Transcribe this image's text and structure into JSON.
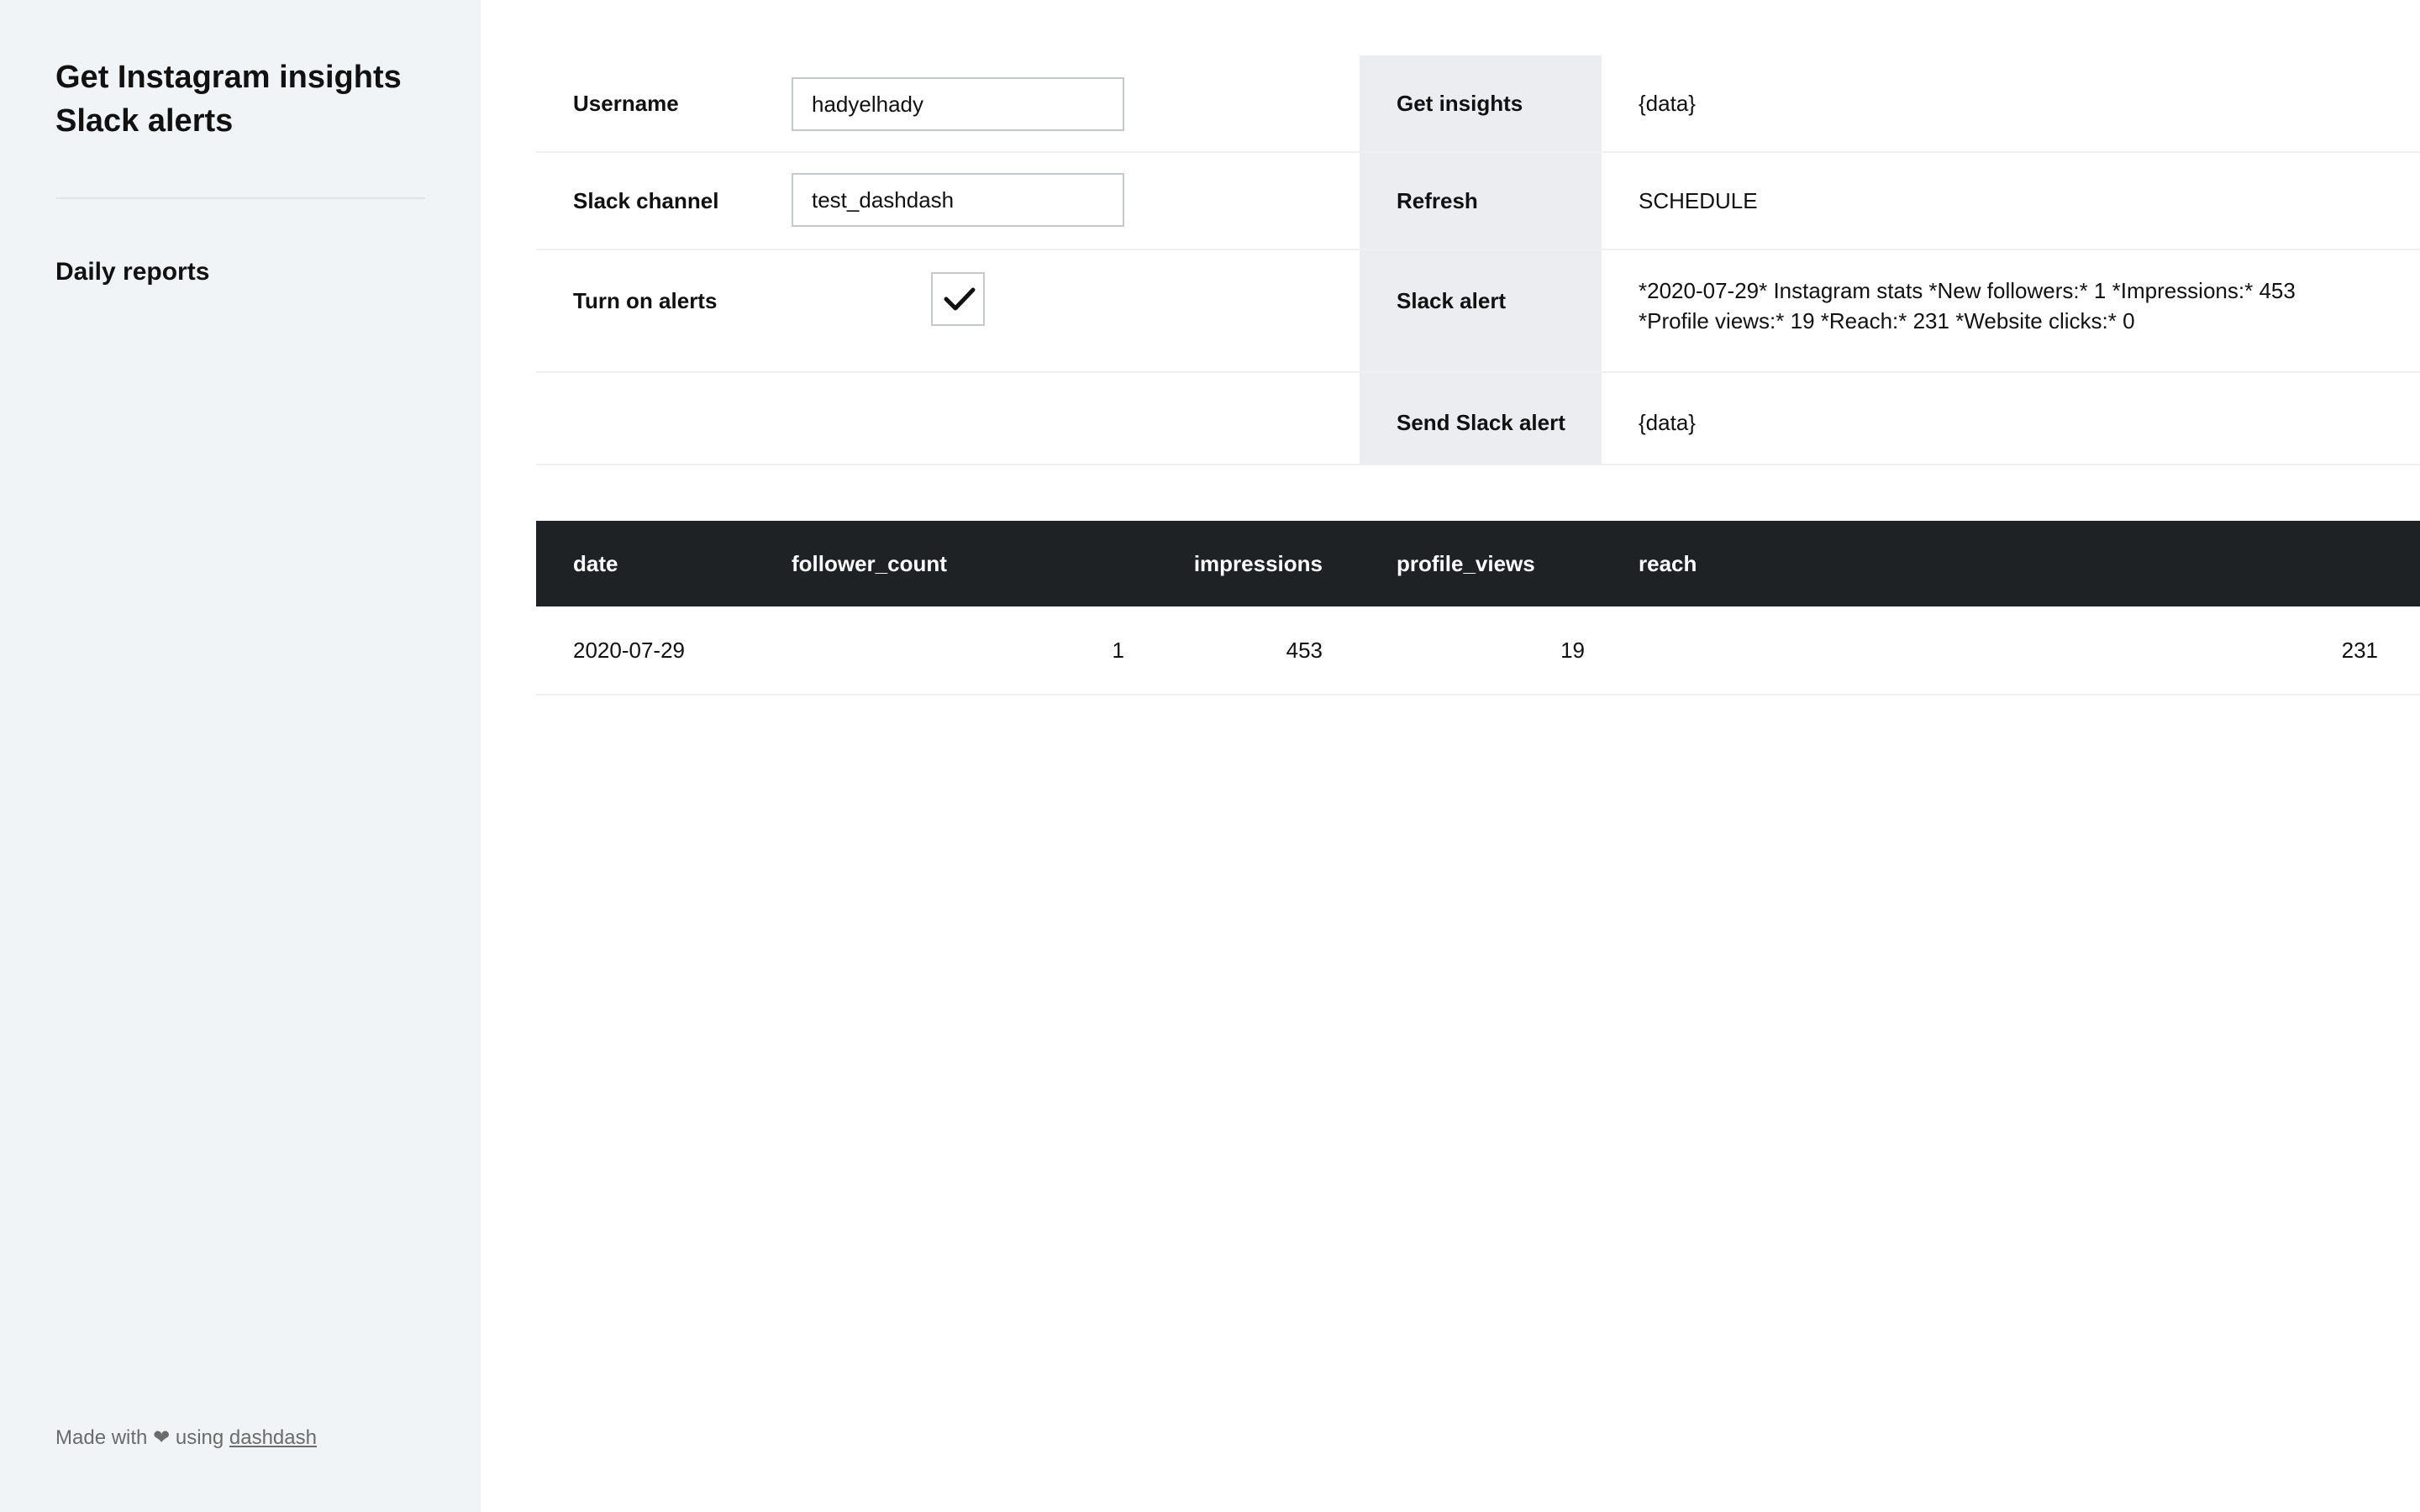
{
  "sidebar": {
    "title": "Get Instagram insights Slack alerts",
    "nav_item": "Daily reports",
    "footer": {
      "made_with": "Made with",
      "heart": "❤",
      "using": "using",
      "link": "dashdash"
    }
  },
  "form": {
    "username": {
      "label": "Username",
      "value": "hadyelhady"
    },
    "slack_channel": {
      "label": "Slack channel",
      "value": "test_dashdash"
    },
    "alerts": {
      "label": "Turn on alerts",
      "checked": true
    }
  },
  "actions": {
    "get_insights": {
      "label": "Get insights",
      "value": "{data}"
    },
    "refresh": {
      "label": "Refresh",
      "value": "SCHEDULE"
    },
    "slack_alert": {
      "label": "Slack alert",
      "line1": "*2020-07-29* Instagram stats *New followers:* 1 *Impressions:* 453",
      "line2": "*Profile views:* 19 *Reach:* 231 *Website clicks:* 0"
    },
    "send_slack_alert": {
      "label": "Send Slack alert",
      "value": "{data}"
    }
  },
  "table": {
    "columns": [
      "date",
      "follower_count",
      "impressions",
      "profile_views",
      "reach"
    ],
    "rows": [
      [
        "2020-07-29",
        "1",
        "453",
        "19",
        "231"
      ]
    ]
  },
  "colors": {
    "sidebar_bg": "#f1f4f6",
    "table_header_bg": "#1f2225",
    "action_cell_bg": "#ebedf0"
  }
}
